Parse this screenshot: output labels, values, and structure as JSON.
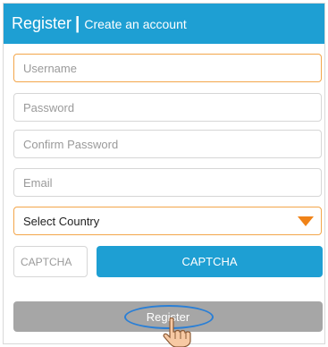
{
  "header": {
    "title": "Register",
    "separator": "|",
    "subtitle": "Create an account"
  },
  "form": {
    "username_placeholder": "Username",
    "password_placeholder": "Password",
    "confirm_password_placeholder": "Confirm Password",
    "email_placeholder": "Email",
    "country_selected": "Select Country",
    "captcha_placeholder": "CAPTCHA",
    "captcha_button_label": "CAPTCHA",
    "register_button_label": "Register"
  },
  "colors": {
    "header_bg": "#1e9fd3",
    "accent_orange": "#f3a64a",
    "dropdown_caret": "#f08318",
    "register_disabled": "#a6a6a6",
    "focus_ring": "#2a7fd6"
  },
  "icons": {
    "dropdown": "triangle-down-icon",
    "pointer": "hand-pointer-icon"
  }
}
